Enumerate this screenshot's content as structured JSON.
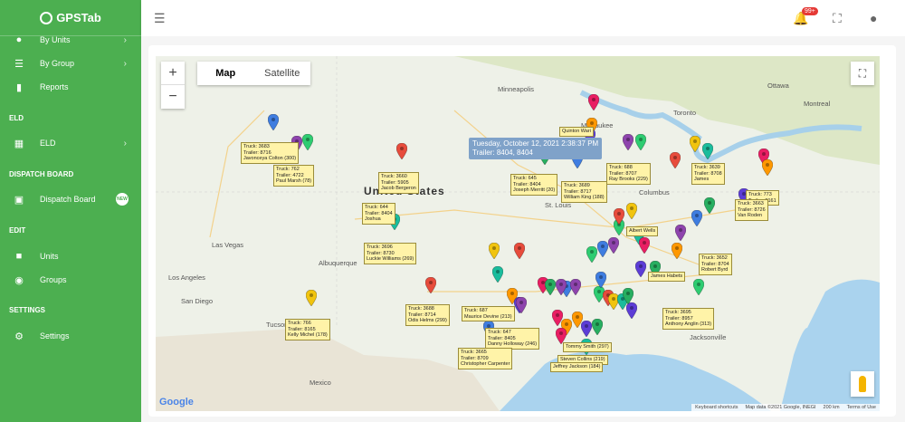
{
  "app": {
    "brand": "GPSTab"
  },
  "sidebar": {
    "items": [
      {
        "label": "By Units",
        "icon": "map-pin-icon"
      },
      {
        "label": "By Group",
        "icon": "list-icon"
      },
      {
        "label": "Reports",
        "icon": "bar-chart-icon"
      },
      {
        "label": "ELD",
        "icon": "grid-icon"
      },
      {
        "label": "Dispatch Board",
        "icon": "board-icon"
      },
      {
        "label": "Units",
        "icon": "truck-icon"
      },
      {
        "label": "Groups",
        "icon": "people-icon"
      },
      {
        "label": "Settings",
        "icon": "gear-icon"
      }
    ],
    "sections": [
      "ELD",
      "DISPATCH BOARD",
      "EDIT",
      "SETTINGS"
    ],
    "new_badge": "NEW"
  },
  "topbar": {
    "notifications": "99+"
  },
  "map": {
    "type_buttons": {
      "map": "Map",
      "satellite": "Satellite"
    },
    "zoom_in": "+",
    "zoom_out": "−",
    "tooltip": {
      "line1": "Tuesday, October 12, 2021 2:38:37 PM",
      "line2": "Trailer: 8404, 8404"
    },
    "google": "Google",
    "attribution": [
      "Keyboard shortcuts",
      "Map data ©2021 Google, INEGI",
      "200 km",
      "Terms of Use"
    ],
    "place_labels": {
      "minneapolis": "Minneapolis",
      "milwaukee": "Milwaukee",
      "toronto": "Toronto",
      "ottawa": "Ottawa",
      "montreal": "Montreal",
      "united_states": "United States",
      "columbus": "Columbus",
      "st_louis": "St. Louis",
      "las_vegas": "Las Vegas",
      "albuquerque": "Albuquerque",
      "los_angeles": "Los Angeles",
      "san_diego": "San Diego",
      "tucson": "Tucson",
      "jacksonville": "Jacksonville",
      "mexico": "Mexico"
    },
    "labels": [
      {
        "lines": [
          "Truck: 3683",
          "Trailer: 8716",
          "Javonceya Colton (300)"
        ]
      },
      {
        "lines": [
          "Truck: 762",
          "Trailer: 4722",
          "Paul Marsh (78)"
        ]
      },
      {
        "lines": [
          "Truck: 3660",
          "Trailer: 5905",
          "Jacob Bergeron"
        ]
      },
      {
        "lines": [
          "Truck: 644",
          "Trailer: 8404",
          "Joshua"
        ]
      },
      {
        "lines": [
          "Truck: 3696",
          "Trailer: 8730",
          "Luckie Williams (269)"
        ]
      },
      {
        "lines": [
          "Truck: 645",
          "Trailer: 8404",
          "Joseph Merritt (20)"
        ]
      },
      {
        "lines": [
          "Truck: 3689",
          "Trailer: 8717",
          "William King (188)"
        ]
      },
      {
        "lines": [
          "Truck: 688",
          "Trailer: 8707",
          "Ray Brooks (229)"
        ]
      },
      {
        "lines": [
          "Truck: 3639",
          "Trailer: 8708",
          "James"
        ]
      },
      {
        "lines": [
          "Truck: 773",
          "Trailer: 8161"
        ]
      },
      {
        "lines": [
          "Truck: 3663",
          "Trailer: 8726",
          "Van Roden"
        ]
      },
      {
        "lines": [
          "Truck: 3652",
          "Trailer: 8704",
          "Robert Byrd"
        ]
      },
      {
        "lines": [
          "Truck: 3688",
          "Trailer: 8714",
          "Odis Helms (299)"
        ]
      },
      {
        "lines": [
          "Truck: 766",
          "Trailer: 8165",
          "Kelly Michel (178)"
        ]
      },
      {
        "lines": [
          "Truck: 687",
          "Maurice Devine (213)"
        ]
      },
      {
        "lines": [
          "Truck: 647",
          "Trailer: 8405",
          "Danny Holloway (246)"
        ]
      },
      {
        "lines": [
          "Truck: 3665",
          "Trailer: 8709",
          "Christopher Carpenter"
        ]
      },
      {
        "lines": [
          "Tommy Smith (297)"
        ]
      },
      {
        "lines": [
          "Steven Collins (219)"
        ]
      },
      {
        "lines": [
          "Jeffrey Jackson (184)"
        ]
      },
      {
        "lines": [
          "Truck: 3695",
          "Trailer: 8957",
          "Anthony Anglin (313)"
        ]
      },
      {
        "lines": [
          "James Habets"
        ]
      },
      {
        "lines": [
          "Albert Wells"
        ]
      },
      {
        "lines": [
          "Quinton Wari"
        ]
      }
    ]
  },
  "colors": {
    "sidebar": "#4caf50",
    "label_bg": "#fff3a8",
    "tooltip": "#7fa2c9"
  }
}
